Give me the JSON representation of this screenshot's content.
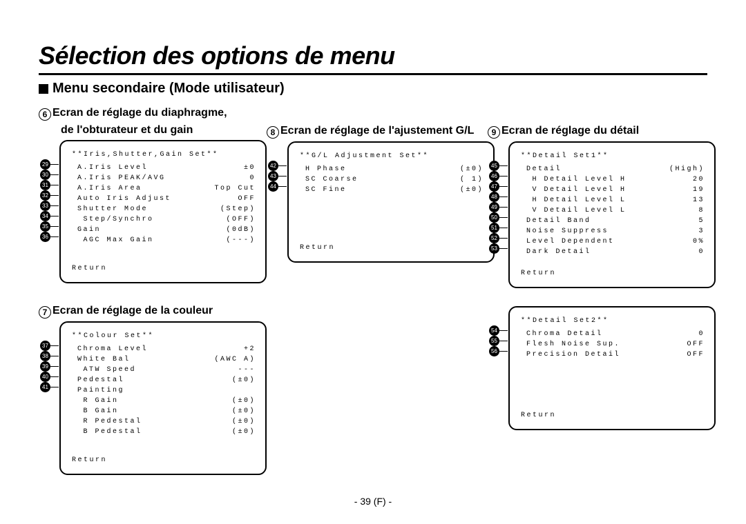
{
  "page_title": "Sélection des options de menu",
  "section_title": "Menu secondaire (Mode utilisateur)",
  "footer": "- 39 (F) -",
  "block6": {
    "circ": "6",
    "title_a": "Ecran de réglage du diaphragme,",
    "title_b": "de l'obturateur et du gain",
    "head": "**Iris,Shutter,Gain Set**",
    "rows": [
      {
        "n": "29",
        "l": "A.Iris Level",
        "v": "±0"
      },
      {
        "n": "30",
        "l": "A.Iris PEAK/AVG",
        "v": "0"
      },
      {
        "n": "31",
        "l": "A.Iris Area",
        "v": "Top Cut"
      },
      {
        "n": "32",
        "l": "Auto Iris Adjust",
        "v": "OFF"
      },
      {
        "n": "33",
        "l": "Shutter Mode",
        "v": "(Step)"
      },
      {
        "n": "34",
        "l": " Step/Synchro",
        "v": "(OFF)"
      },
      {
        "n": "35",
        "l": "Gain",
        "v": "(0dB)"
      },
      {
        "n": "36",
        "l": " AGC Max Gain",
        "v": "(---)"
      }
    ],
    "return": "Return"
  },
  "block7": {
    "circ": "7",
    "title": "Ecran de réglage de la couleur",
    "head": "**Colour Set**",
    "rows": [
      {
        "n": "37",
        "l": "Chroma Level",
        "v": "+2"
      },
      {
        "n": "38",
        "l": "White Bal",
        "v": "(AWC A)"
      },
      {
        "n": "39",
        "l": " ATW Speed",
        "v": "---"
      },
      {
        "n": "40",
        "l": "Pedestal",
        "v": "(±0)"
      },
      {
        "n": "41",
        "l": "Painting",
        "v": ""
      }
    ],
    "extra": [
      {
        "l": " R Gain",
        "v": "(±0)"
      },
      {
        "l": " B Gain",
        "v": "(±0)"
      },
      {
        "l": " R Pedestal",
        "v": "(±0)"
      },
      {
        "l": " B Pedestal",
        "v": "(±0)"
      }
    ],
    "return": "Return"
  },
  "block8": {
    "circ": "8",
    "title": "Ecran de réglage de l'ajustement G/L",
    "head": "**G/L Adjustment Set**",
    "rows": [
      {
        "n": "42",
        "l": "H Phase",
        "v": "(±0)"
      },
      {
        "n": "43",
        "l": "SC Coarse",
        "v": "( 1)"
      },
      {
        "n": "44",
        "l": "SC Fine",
        "v": "(±0)"
      }
    ],
    "return": "Return"
  },
  "block9": {
    "circ": "9",
    "title": "Ecran de réglage du détail",
    "head": "**Detail Set1**",
    "rows": [
      {
        "n": "45",
        "l": "Detail",
        "v": "(High)"
      },
      {
        "n": "46",
        "l": " H Detail Level H",
        "v": "20"
      },
      {
        "n": "47",
        "l": " V Detail Level H",
        "v": "19"
      },
      {
        "n": "48",
        "l": " H Detail Level L",
        "v": "13"
      },
      {
        "n": "49",
        "l": " V Detail Level L",
        "v": "8"
      },
      {
        "n": "50",
        "l": "Detail Band",
        "v": "5"
      },
      {
        "n": "51",
        "l": "Noise Suppress",
        "v": "3"
      },
      {
        "n": "52",
        "l": "Level Dependent",
        "v": "0%"
      },
      {
        "n": "53",
        "l": "Dark Detail",
        "v": "0"
      }
    ],
    "return": "Return"
  },
  "block9b": {
    "head": "**Detail Set2**",
    "rows": [
      {
        "n": "54",
        "l": "Chroma Detail",
        "v": "0"
      },
      {
        "n": "55",
        "l": "Flesh Noise Sup.",
        "v": "OFF"
      },
      {
        "n": "56",
        "l": "Precision Detail",
        "v": "OFF"
      }
    ],
    "return": "Return"
  }
}
